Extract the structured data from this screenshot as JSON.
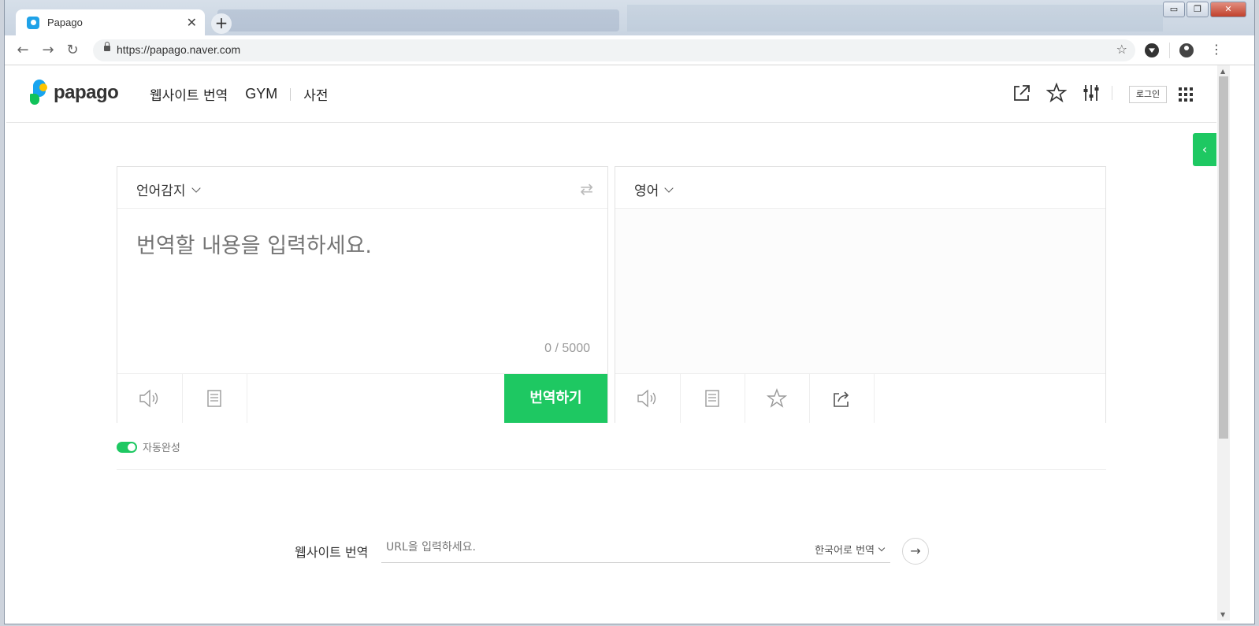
{
  "browser": {
    "tab_title": "Papago",
    "tab_close": "✕",
    "new_tab": "+",
    "url": "https://papago.naver.com",
    "window_controls": {
      "minimize": "▭",
      "restore": "❐",
      "close": "✕"
    },
    "nav": {
      "back": "←",
      "forward": "→",
      "reload": "↻"
    },
    "bookmark_star": "☆",
    "menu": "⋮"
  },
  "header": {
    "logo_text": "papago",
    "nav_items": [
      "웹사이트 번역",
      "GYM",
      "사전"
    ],
    "login_label": "로그인",
    "icons": [
      "popout-icon",
      "favorite-star-icon",
      "settings-sliders-icon",
      "apps-grid-icon"
    ]
  },
  "side_tab_glyph": "‹",
  "source": {
    "language": "언어감지",
    "swap_glyph": "⇄",
    "placeholder": "번역할 내용을 입력하세요.",
    "value": "",
    "counter": "0 / 5000",
    "translate_label": "번역하기"
  },
  "target": {
    "language": "영어"
  },
  "autocomplete_label": "자동완성",
  "website_translation": {
    "label": "웹사이트 번역",
    "placeholder": "URL을 입력하세요.",
    "target_language": "한국어로 번역",
    "go_glyph": "→"
  },
  "colors": {
    "brand_green": "#1ec862",
    "logo_blue": "#18a4ef",
    "logo_yellow": "#ffc400"
  }
}
